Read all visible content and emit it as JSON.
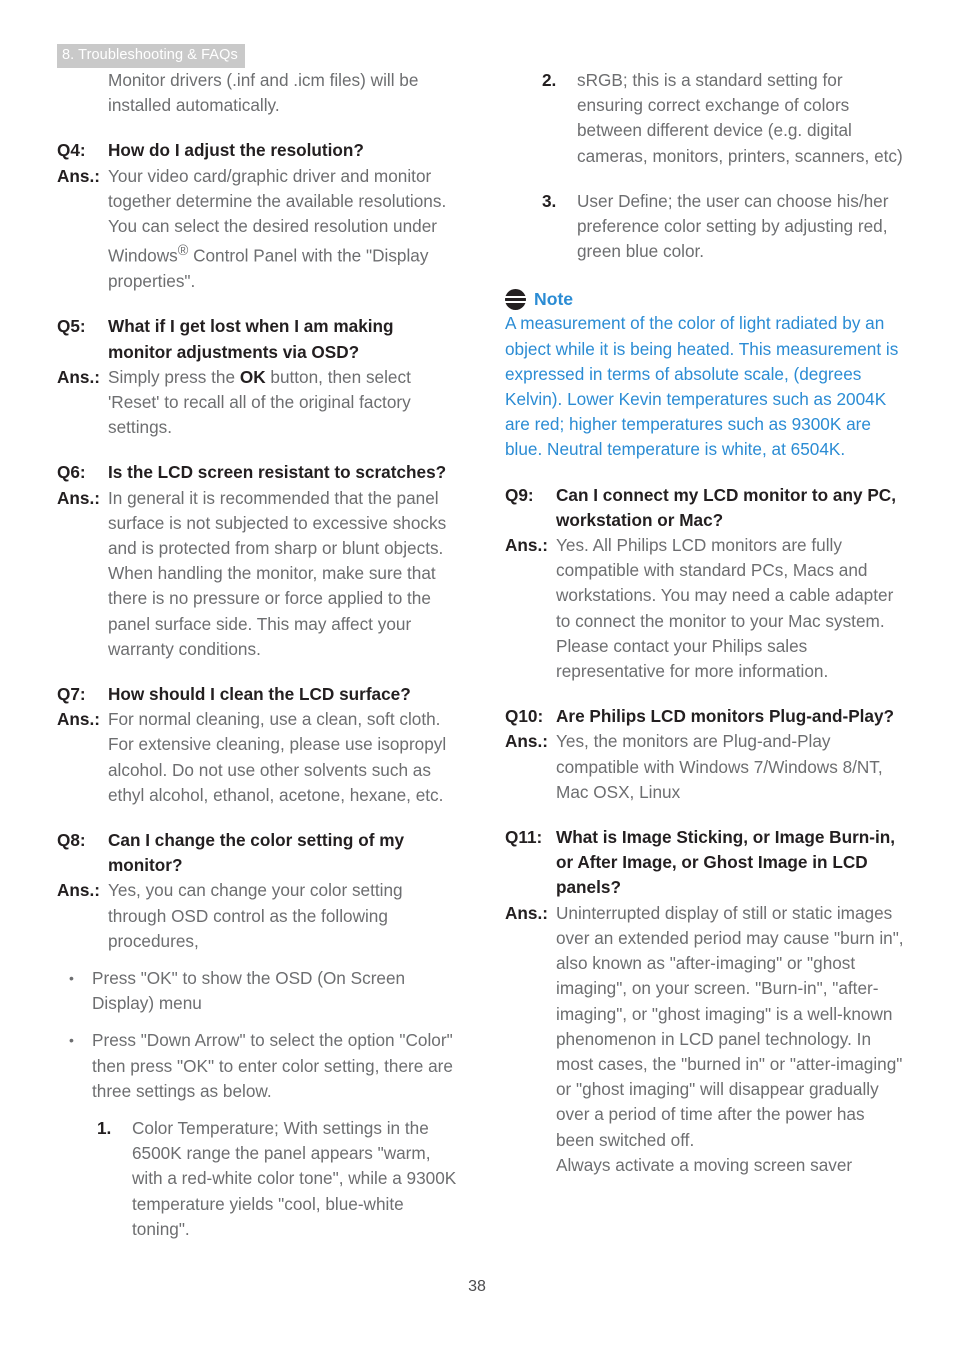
{
  "header": {
    "chapter": "8. Troubleshooting & FAQs"
  },
  "footer": {
    "page_number": "38"
  },
  "colors": {
    "header_band": "#c9c9c9",
    "header_text": "#ffffff",
    "body_text": "#6d6e70",
    "emphasis_text": "#231f20",
    "note_blue": "#2b8cd4"
  },
  "left_column": {
    "intro_paragraph": "Monitor drivers (.inf and .icm files) will be installed automatically.",
    "qa": [
      {
        "q_label": "Q4:",
        "question": "How do I adjust the resolution?",
        "a_label": "Ans.:",
        "answer_part1": "Your video card/graphic driver and monitor together determine the available resolutions. You can select the desired resolution under Windows",
        "answer_superscript": "®",
        "answer_part2": " Control Panel with the \"Display properties\"."
      },
      {
        "q_label": "Q5:",
        "question": "What if I get lost when I am making monitor adjustments via OSD?",
        "a_label": "Ans.:",
        "answer_part1": "Simply press the ",
        "answer_bold": "OK",
        "answer_part2": " button, then select 'Reset' to recall all of the original factory settings."
      },
      {
        "q_label": "Q6:",
        "question": "Is the LCD screen resistant to scratches?",
        "a_label": "Ans.:",
        "answer": "In general it is recommended that the panel surface is not subjected to excessive shocks and is protected from sharp or blunt objects. When handling the monitor, make sure that there is no pressure or force applied to the panel surface side. This may affect your warranty conditions."
      },
      {
        "q_label": "Q7:",
        "question": "How should I clean the LCD surface?",
        "a_label": "Ans.:",
        "answer": "For normal cleaning, use a clean, soft cloth. For extensive cleaning, please use isopropyl alcohol. Do not use other solvents such as ethyl alcohol, ethanol, acetone, hexane, etc."
      },
      {
        "q_label": "Q8:",
        "question": "Can I change the color setting of my monitor?",
        "a_label": "Ans.:",
        "answer": "Yes, you can change your color setting through OSD control as the following procedures,"
      }
    ],
    "bullets": [
      {
        "mark": "•",
        "text": "Press \"OK\" to show the OSD (On Screen Display) menu"
      },
      {
        "mark": "•",
        "text": "Press \"Down Arrow\" to select the option \"Color\" then press \"OK\" to enter color setting, there are three settings as below."
      }
    ],
    "numbered": [
      {
        "mark": "1.",
        "text": "Color Temperature; With settings in the 6500K range the panel appears \"warm, with a red-white color tone\", while a 9300K temperature yields \"cool, blue-white toning\"."
      }
    ]
  },
  "right_column": {
    "numbered": [
      {
        "mark": "2.",
        "text": "sRGB; this is a standard setting for ensuring correct exchange of colors between different device (e.g. digital cameras, monitors, printers, scanners, etc)"
      },
      {
        "mark": "3.",
        "text": "User Define; the user can choose his/her preference color setting by adjusting red, green blue color."
      }
    ],
    "note": {
      "icon": "note-circle-icon",
      "title": "Note",
      "body": "A measurement of the color of light radiated by an object while it is being heated. This measurement is expressed in terms of absolute scale, (degrees Kelvin). Lower Kevin temperatures such as 2004K are red; higher temperatures such as 9300K are blue. Neutral temperature is white, at 6504K."
    },
    "qa": [
      {
        "q_label": "Q9:",
        "question": "Can I connect my LCD monitor to any PC, workstation or Mac?",
        "a_label": "Ans.:",
        "answer": "Yes. All Philips LCD monitors are fully compatible with standard PCs, Macs and workstations. You may need a cable adapter to connect the monitor to your Mac system. Please contact your Philips sales representative for more information."
      },
      {
        "q_label": "Q10:",
        "question": "Are Philips LCD monitors Plug-and-Play?",
        "a_label": "Ans.:",
        "answer": "Yes, the monitors are Plug-and-Play compatible with Windows 7/Windows 8/NT, Mac OSX, Linux"
      },
      {
        "q_label": "Q11:",
        "question": "What is Image Sticking, or Image Burn-in, or After Image, or Ghost Image in LCD panels?",
        "a_label": "Ans.:",
        "answer": "Uninterrupted display of still or static images over an extended period may cause \"burn in\", also known as \"after-imaging\" or \"ghost imaging\", on your screen. \"Burn-in\", \"after-imaging\", or \"ghost imaging\" is a well-known phenomenon in LCD panel technology. In most cases, the \"burned in\" or \"atter-imaging\" or \"ghost imaging\" will disappear gradually over a period of time after the power has been switched off.",
        "answer_continued": "Always activate a moving screen saver"
      }
    ]
  }
}
